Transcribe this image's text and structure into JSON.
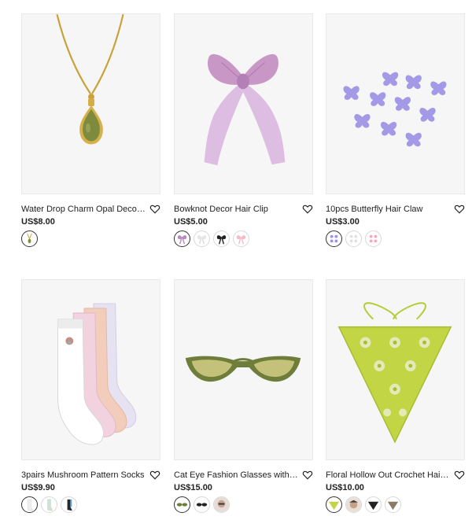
{
  "products": [
    {
      "title": "Water Drop Charm Opal Decor ...",
      "price": "US$8.00",
      "image": "opal-necklace-image",
      "swatches": [
        {
          "name": "gold-necklace-swatch",
          "selected": true
        }
      ]
    },
    {
      "title": "Bowknot Decor Hair Clip",
      "price": "US$5.00",
      "image": "pink-bow-clip-image",
      "swatches": [
        {
          "name": "purple-bow-swatch",
          "selected": true
        },
        {
          "name": "white-bow-swatch",
          "selected": false
        },
        {
          "name": "black-bow-swatch",
          "selected": false
        },
        {
          "name": "pink-bow-swatch",
          "selected": false
        }
      ]
    },
    {
      "title": "10pcs Butterfly Hair Claw",
      "price": "US$3.00",
      "image": "purple-butterfly-claws-image",
      "swatches": [
        {
          "name": "purple-claw-swatch",
          "selected": true
        },
        {
          "name": "white-claw-swatch",
          "selected": false
        },
        {
          "name": "pink-claw-swatch",
          "selected": false
        }
      ]
    },
    {
      "title": "3pairs Mushroom Pattern Socks",
      "price": "US$9.90",
      "image": "pastel-socks-image",
      "swatches": [
        {
          "name": "white-sock-swatch",
          "selected": true
        },
        {
          "name": "green-sock-swatch",
          "selected": false
        },
        {
          "name": "black-sock-swatch",
          "selected": false
        }
      ]
    },
    {
      "title": "Cat Eye Fashion Glasses with Box",
      "price": "US$15.00",
      "image": "green-cat-eye-glasses-image",
      "swatches": [
        {
          "name": "green-glasses-swatch",
          "selected": true
        },
        {
          "name": "black-glasses-swatch",
          "selected": false
        },
        {
          "name": "model-glasses-swatch",
          "selected": false
        }
      ]
    },
    {
      "title": "Floral Hollow Out Crochet Hair ...",
      "price": "US$10.00",
      "image": "lime-crochet-bandana-image",
      "swatches": [
        {
          "name": "lime-bandana-swatch",
          "selected": true
        },
        {
          "name": "model-bandana-swatch",
          "selected": false
        },
        {
          "name": "black-bandana-swatch",
          "selected": false
        },
        {
          "name": "brown-bandana-swatch",
          "selected": false
        }
      ]
    }
  ],
  "icons": {
    "favorite": "heart-outline-icon"
  },
  "colors": {
    "text": "#222222",
    "price": "#222222",
    "image_bg": "#f6f6f6",
    "selected_swatch_border": "#333333"
  }
}
